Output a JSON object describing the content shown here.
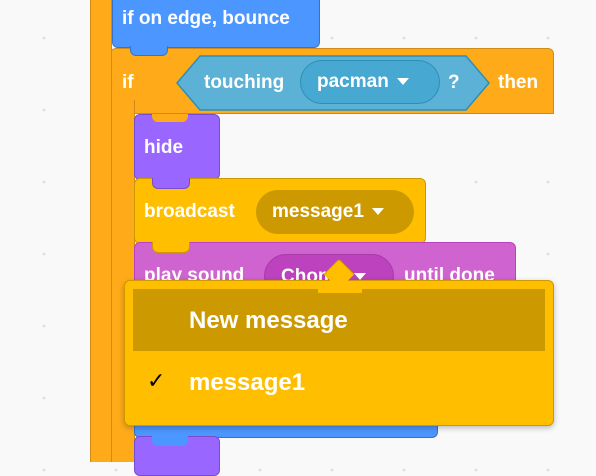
{
  "blocks": {
    "bounce": {
      "label": "if on edge, bounce"
    },
    "if_block": {
      "if_label": "if",
      "then_label": "then"
    },
    "sensing": {
      "label": "touching",
      "target": "pacman",
      "question": "?"
    },
    "hide": {
      "label": "hide"
    },
    "broadcast": {
      "label": "broadcast",
      "message": "message1"
    },
    "play_sound": {
      "label": "play sound",
      "sound": "Chomp",
      "suffix": "until done"
    }
  },
  "dropdown": {
    "items": [
      {
        "label": "New message",
        "checked": false
      },
      {
        "label": "message1",
        "checked": true
      }
    ],
    "check_glyph": "✓"
  },
  "colors": {
    "motion": "#4c97ff",
    "control": "#ffab19",
    "looks": "#9966ff",
    "events": "#ffbf00",
    "sound": "#cf63cf",
    "sensing": "#5cb1d6"
  }
}
